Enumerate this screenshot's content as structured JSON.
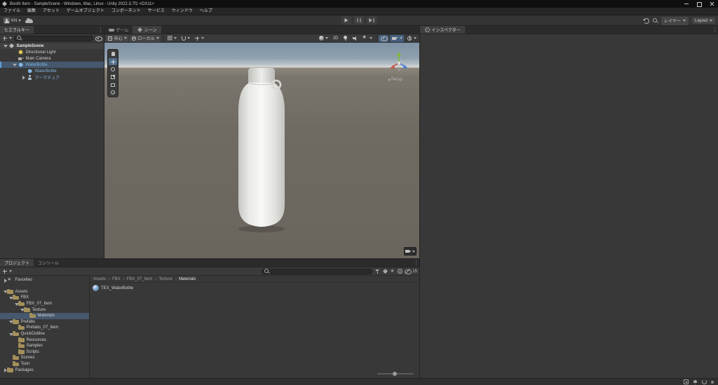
{
  "window": {
    "title": "Booth Item - SampleScene - Windows, Mac, Linux - Unity 2022.3.7f1 <DX11>"
  },
  "menu_bar": {
    "items": [
      "ファイル",
      "編集",
      "アセット",
      "ゲームオブジェクト",
      "コンポーネント",
      "サービス",
      "ウィンドウ",
      "ヘルプ"
    ]
  },
  "toolbar": {
    "account_label": "KN",
    "layers_label": "レイヤー",
    "layout_label": "Layout"
  },
  "hierarchy": {
    "tab_label": "ヒエラルキー",
    "items": [
      {
        "label": "SampleScene",
        "type": "scene",
        "depth": 0,
        "expanded": true,
        "bold": true
      },
      {
        "label": "Directional Light",
        "type": "light",
        "depth": 1
      },
      {
        "label": "Main Camera",
        "type": "camera",
        "depth": 1
      },
      {
        "label": "WaterBottle",
        "type": "prefab",
        "depth": 1,
        "expanded": true,
        "selected": true
      },
      {
        "label": "WaterBottle",
        "type": "prefab",
        "depth": 2
      },
      {
        "label": "アーマチュア",
        "type": "avatar",
        "depth": 2,
        "expanded": false
      }
    ]
  },
  "scene_view": {
    "tabs": [
      {
        "label": "ゲーム",
        "icon": "gamepad"
      },
      {
        "label": "シーン",
        "icon": "scene-tab",
        "active": true
      }
    ],
    "toolbar": {
      "pivot_label": "中心",
      "orientation_label": "ローカル",
      "mode_2d_label": "2D"
    },
    "projection_label": "Persp"
  },
  "inspector": {
    "tab_label": "インスペクター"
  },
  "project": {
    "tabs": [
      {
        "label": "プロジェクト",
        "active": true
      },
      {
        "label": "コンソール"
      }
    ],
    "hidden_count": "15",
    "tree": [
      {
        "label": "Favorites",
        "depth": 0,
        "icon": "star",
        "expanded": false,
        "section": true
      },
      {
        "label": "Assets",
        "depth": 0,
        "icon": "folder",
        "expanded": true
      },
      {
        "label": "FBX",
        "depth": 1,
        "icon": "folder",
        "expanded": true
      },
      {
        "label": "FBX_07_Item",
        "depth": 2,
        "icon": "folder",
        "expanded": true
      },
      {
        "label": "Texture",
        "depth": 3,
        "icon": "folder",
        "expanded": true
      },
      {
        "label": "Materials",
        "depth": 4,
        "icon": "folder",
        "selected": true
      },
      {
        "label": "Prefabs",
        "depth": 1,
        "icon": "folder",
        "expanded": true
      },
      {
        "label": "Prefabs_07_Item",
        "depth": 2,
        "icon": "folder"
      },
      {
        "label": "QuickOutline",
        "depth": 1,
        "icon": "folder",
        "expanded": true
      },
      {
        "label": "Resources",
        "depth": 2,
        "icon": "folder"
      },
      {
        "label": "Samples",
        "depth": 2,
        "icon": "folder"
      },
      {
        "label": "Scripts",
        "depth": 2,
        "icon": "folder"
      },
      {
        "label": "Scenes",
        "depth": 1,
        "icon": "folder"
      },
      {
        "label": "Toon",
        "depth": 1,
        "icon": "folder"
      },
      {
        "label": "Packages",
        "depth": 0,
        "icon": "folder",
        "expanded": false
      }
    ],
    "breadcrumbs": [
      "Assets",
      "FBX",
      "FBX_07_Item",
      "Texture",
      "Materials"
    ],
    "content_items": [
      {
        "label": "TEX_WaterBottle",
        "icon": "material"
      }
    ]
  }
}
